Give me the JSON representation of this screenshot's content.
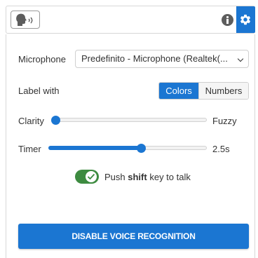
{
  "toolbar": {
    "voice_button_icon": "speaking-head-icon",
    "info_icon": "info-icon",
    "settings_icon": "gear-icon"
  },
  "settings": {
    "microphone": {
      "label": "Microphone",
      "selected": "Predefinito - Microphone (Realtek(..."
    },
    "label_with": {
      "label": "Label with",
      "options": [
        "Colors",
        "Numbers"
      ],
      "selected": "Colors"
    },
    "clarity": {
      "label": "Clarity",
      "value_label": "Fuzzy",
      "value_fraction": 0.0
    },
    "timer": {
      "label": "Timer",
      "value_label": "2.5s",
      "value_fraction": 0.59
    },
    "push_to_talk": {
      "enabled": true,
      "text_before": "Push",
      "key": "shift",
      "text_after": "key to talk"
    }
  },
  "actions": {
    "disable_label": "DISABLE VOICE RECOGNITION"
  },
  "colors": {
    "accent": "#1b76d2",
    "toggle_on": "#3d8b40"
  }
}
